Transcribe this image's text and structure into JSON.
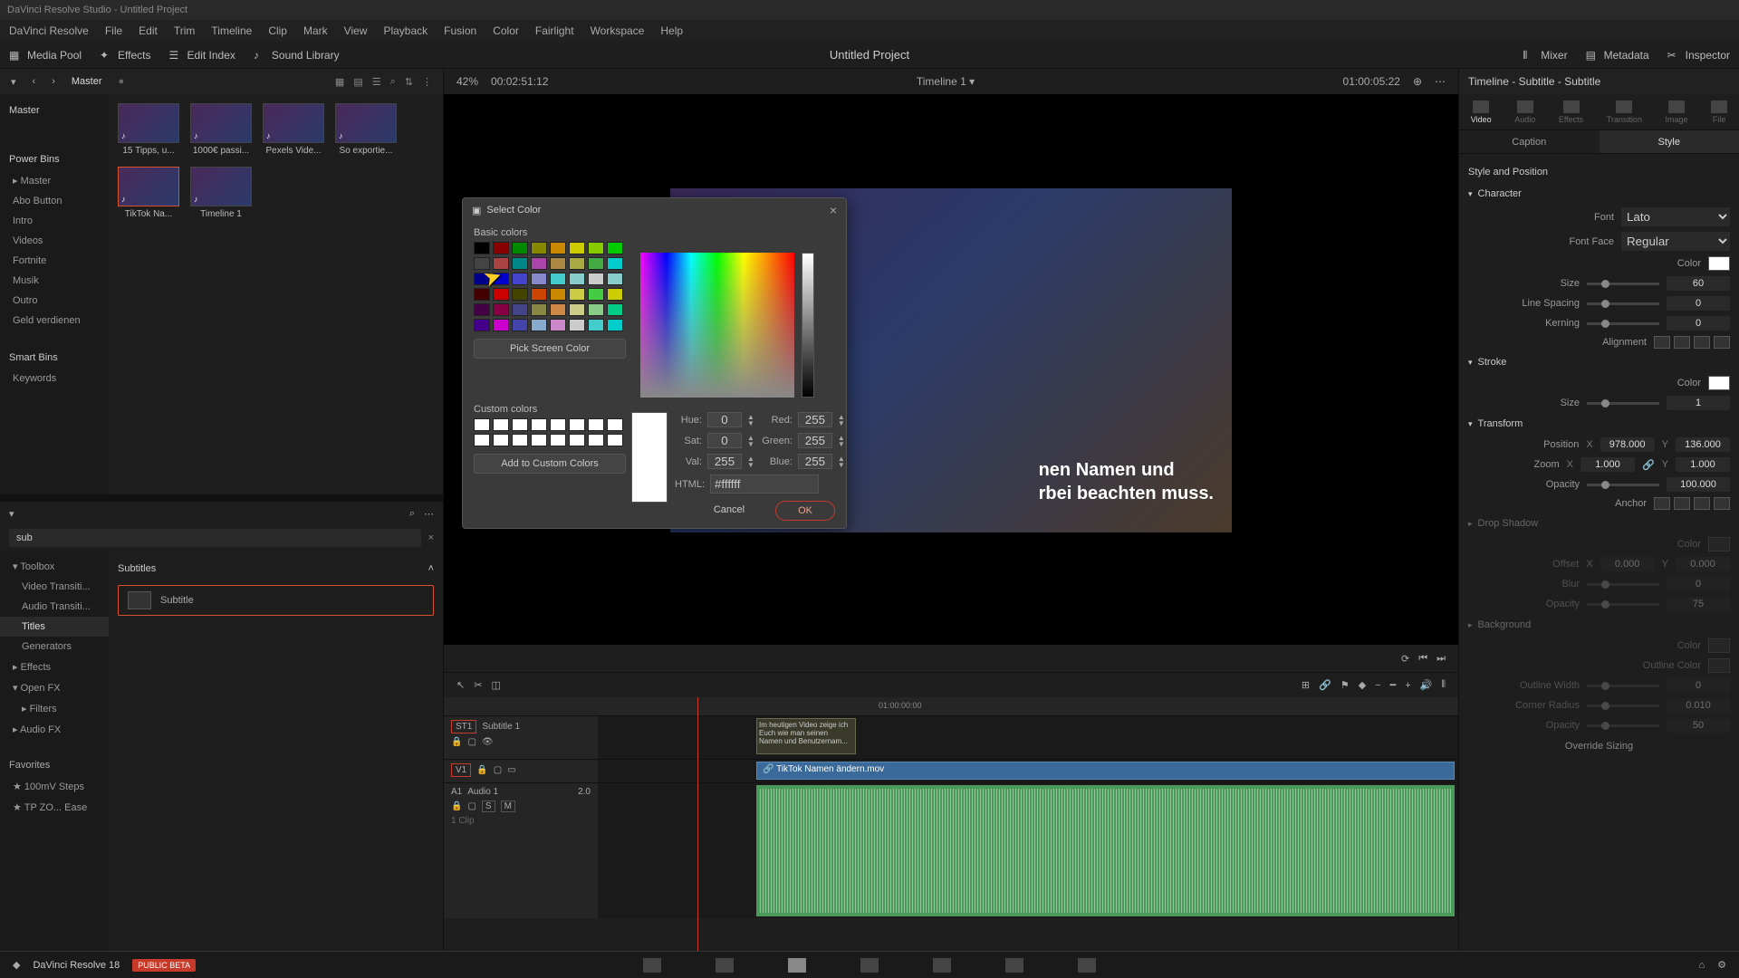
{
  "titlebar": "DaVinci Resolve Studio - Untitled Project",
  "menu": [
    "DaVinci Resolve",
    "File",
    "Edit",
    "Trim",
    "Timeline",
    "Clip",
    "Mark",
    "View",
    "Playback",
    "Fusion",
    "Color",
    "Fairlight",
    "Workspace",
    "Help"
  ],
  "toolbar": {
    "mediaPool": "Media Pool",
    "effects": "Effects",
    "editIndex": "Edit Index",
    "soundLibrary": "Sound Library",
    "mixer": "Mixer",
    "metadata": "Metadata",
    "inspector": "Inspector"
  },
  "project": "Untitled Project",
  "masterLabel": "Master",
  "zoom": "42%",
  "sourceTC": "00:02:51:12",
  "timelineName": "Timeline 1",
  "recordTC": "01:00:05:22",
  "clips": [
    {
      "name": "15 Tipps, u..."
    },
    {
      "name": "1000€ passi..."
    },
    {
      "name": "Pexels Vide..."
    },
    {
      "name": "So exportie..."
    },
    {
      "name": "TikTok Na...",
      "sel": true
    },
    {
      "name": "Timeline 1"
    }
  ],
  "bins": {
    "powerBins": "Power Bins",
    "master": "Master",
    "items": [
      "Abo Button",
      "Intro",
      "Videos",
      "Fortnite",
      "Musik",
      "Outro",
      "Geld verdienen"
    ],
    "smartBins": "Smart Bins",
    "smartItems": [
      "Keywords"
    ]
  },
  "fxSearch": "sub",
  "fxTree": {
    "toolbox": "Toolbox",
    "videoTrans": "Video Transiti...",
    "audioTrans": "Audio Transiti...",
    "titles": "Titles",
    "generators": "Generators",
    "effects": "Effects",
    "openfx": "Open FX",
    "filters": "Filters",
    "audiofx": "Audio FX",
    "favorites": "Favorites",
    "fav1": "100mV Steps",
    "fav2": "TP ZO... Ease"
  },
  "fxCat": "Subtitles",
  "fxItem": "Subtitle",
  "subtitleText": "nen Namen und\nrbei beachten muss.",
  "tracks": {
    "st1": "ST1",
    "subtitle": "Subtitle 1",
    "subClip": "Im heutigen Video zeige ich Euch wie man seinen Namen und Benutzernam...",
    "v1": "V1",
    "vidClip": "TikTok Namen ändern.mov",
    "a1": "A1",
    "audio": "Audio 1",
    "ch": "2.0",
    "clipCount": "1 Clip"
  },
  "ruler": [
    "01:00:00:00",
    ""
  ],
  "inspector": {
    "title": "Timeline - Subtitle - Subtitle",
    "tabs": [
      "Video",
      "Audio",
      "Effects",
      "Transition",
      "Image",
      "File"
    ],
    "subtabs": [
      "Caption",
      "Style"
    ],
    "styleSect": "Style and Position",
    "char": "Character",
    "font": "Font",
    "fontVal": "Lato",
    "fontFace": "Font Face",
    "fontFaceVal": "Regular",
    "color": "Color",
    "size": "Size",
    "sizeVal": "60",
    "lineSpacing": "Line Spacing",
    "lineSpacingVal": "0",
    "kerning": "Kerning",
    "kerningVal": "0",
    "alignment": "Alignment",
    "stroke": "Stroke",
    "strokeSizeVal": "1",
    "transform": "Transform",
    "position": "Position",
    "posX": "978.000",
    "posY": "136.000",
    "zoomLbl": "Zoom",
    "zoomX": "1.000",
    "zoomY": "1.000",
    "opacity": "Opacity",
    "opacityVal": "100.000",
    "anchor": "Anchor",
    "dropShadow": "Drop Shadow",
    "dsColor": "Color",
    "dsOffset": "Offset",
    "dsX": "0.000",
    "dsY": "0.000",
    "dsBlur": "Blur",
    "dsBlurVal": "0",
    "dsOpacity": "Opacity",
    "dsOpacityVal": "75",
    "background": "Background",
    "bgColor": "Color",
    "bgOutlineColor": "Outline Color",
    "bgOutlineWidth": "Outline Width",
    "bgOutlineWidthVal": "0",
    "bgCorner": "Corner Radius",
    "bgCornerVal": "0.010",
    "bgOpacity": "Opacity",
    "bgOpacityVal": "50",
    "overrideSizing": "Override Sizing"
  },
  "dialog": {
    "title": "Select Color",
    "basicColors": "Basic colors",
    "pickScreen": "Pick Screen Color",
    "customColors": "Custom colors",
    "addCustom": "Add to Custom Colors",
    "hue": "Hue:",
    "hueVal": "0",
    "sat": "Sat:",
    "satVal": "0",
    "val": "Val:",
    "valVal": "255",
    "red": "Red:",
    "redVal": "255",
    "green": "Green:",
    "greenVal": "255",
    "blue": "Blue:",
    "blueVal": "255",
    "html": "HTML:",
    "htmlVal": "#ffffff",
    "cancel": "Cancel",
    "ok": "OK",
    "basicSwatches": [
      "#000",
      "#800",
      "#080",
      "#880",
      "#c80",
      "#cc0",
      "#8c0",
      "#0c0",
      "#444",
      "#a44",
      "#088",
      "#a4a",
      "#a84",
      "#aa4",
      "#4a4",
      "#0cc",
      "#008",
      "#00c",
      "#44c",
      "#88c",
      "#4cc",
      "#8cc",
      "#ccc",
      "#8cc",
      "#400",
      "#c00",
      "#440",
      "#c40",
      "#c80",
      "#cc4",
      "#4c4",
      "#cc0",
      "#404",
      "#804",
      "#448",
      "#884",
      "#c84",
      "#cc8",
      "#8c8",
      "#0c8",
      "#408",
      "#c0c",
      "#44a",
      "#8ac",
      "#c8c",
      "#ccc",
      "#4cc",
      "#0cc"
    ]
  },
  "bottomNav": {
    "app": "DaVinci Resolve 18",
    "beta": "PUBLIC BETA"
  }
}
